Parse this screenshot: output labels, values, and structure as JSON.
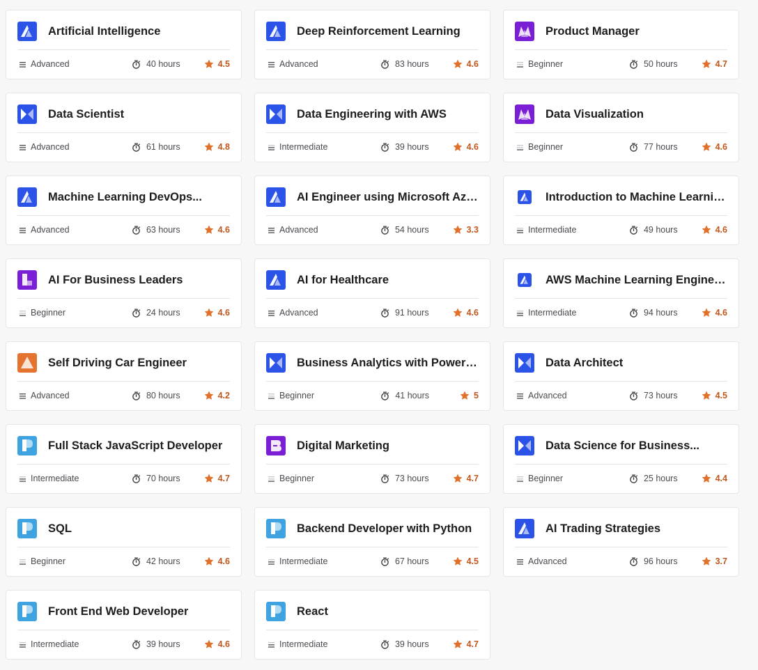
{
  "colors": {
    "blue_logo": "#2b53e8",
    "purple_logo": "#7b1fd6",
    "orange_logo": "#e57330",
    "lightblue_logo": "#3ea3e0",
    "star": "#e0702a",
    "rating_text": "#c0571c"
  },
  "courses": [
    {
      "title": "Artificial Intelligence",
      "level": "Advanced",
      "duration": "40 hours",
      "rating": "4.5",
      "logo": "ai-triangle-logo",
      "logo_color": "#2b53e8"
    },
    {
      "title": "Deep Reinforcement Learning",
      "level": "Advanced",
      "duration": "83 hours",
      "rating": "4.6",
      "logo": "ai-triangle-logo",
      "logo_color": "#2b53e8"
    },
    {
      "title": "Product Manager",
      "level": "Beginner",
      "duration": "50 hours",
      "rating": "4.7",
      "logo": "business-m-logo",
      "logo_color": "#7b1fd6"
    },
    {
      "title": "Data Scientist",
      "level": "Advanced",
      "duration": "61 hours",
      "rating": "4.8",
      "logo": "data-bowtie-logo",
      "logo_color": "#2b53e8"
    },
    {
      "title": "Data Engineering with AWS",
      "level": "Intermediate",
      "duration": "39 hours",
      "rating": "4.6",
      "logo": "data-bowtie-logo",
      "logo_color": "#2b53e8"
    },
    {
      "title": "Data Visualization",
      "level": "Beginner",
      "duration": "77 hours",
      "rating": "4.6",
      "logo": "business-m-logo",
      "logo_color": "#7b1fd6"
    },
    {
      "title": "Machine Learning DevOps...",
      "level": "Advanced",
      "duration": "63 hours",
      "rating": "4.6",
      "logo": "ai-triangle-logo",
      "logo_color": "#2b53e8"
    },
    {
      "title": "AI Engineer using Microsoft Azure",
      "level": "Advanced",
      "duration": "54 hours",
      "rating": "3.3",
      "logo": "ai-triangle-logo",
      "logo_color": "#2b53e8"
    },
    {
      "title": "Introduction to Machine Learning...",
      "level": "Intermediate",
      "duration": "49 hours",
      "rating": "4.6",
      "logo": "ai-triangle-logo",
      "logo_color": "#2b53e8",
      "small_logo": true
    },
    {
      "title": "AI For Business Leaders",
      "level": "Beginner",
      "duration": "24 hours",
      "rating": "4.6",
      "logo": "business-l-logo",
      "logo_color": "#7b1fd6"
    },
    {
      "title": "AI for Healthcare",
      "level": "Advanced",
      "duration": "91 hours",
      "rating": "4.6",
      "logo": "ai-triangle-logo",
      "logo_color": "#2b53e8"
    },
    {
      "title": "AWS Machine Learning Engineer...",
      "level": "Intermediate",
      "duration": "94 hours",
      "rating": "4.6",
      "logo": "ai-triangle-logo",
      "logo_color": "#2b53e8",
      "small_logo": true
    },
    {
      "title": "Self Driving Car Engineer",
      "level": "Advanced",
      "duration": "80 hours",
      "rating": "4.2",
      "logo": "auto-triangle-logo",
      "logo_color": "#e57330"
    },
    {
      "title": "Business Analytics with Power BI",
      "level": "Beginner",
      "duration": "41 hours",
      "rating": "5",
      "logo": "data-bowtie-logo",
      "logo_color": "#2b53e8"
    },
    {
      "title": "Data Architect",
      "level": "Advanced",
      "duration": "73 hours",
      "rating": "4.5",
      "logo": "data-bowtie-logo",
      "logo_color": "#2b53e8"
    },
    {
      "title": "Full Stack JavaScript Developer",
      "level": "Intermediate",
      "duration": "70 hours",
      "rating": "4.7",
      "logo": "programming-p-logo",
      "logo_color": "#3ea3e0"
    },
    {
      "title": "Digital Marketing",
      "level": "Beginner",
      "duration": "73 hours",
      "rating": "4.7",
      "logo": "business-b-logo",
      "logo_color": "#7b1fd6"
    },
    {
      "title": "Data Science for Business...",
      "level": "Beginner",
      "duration": "25 hours",
      "rating": "4.4",
      "logo": "data-bowtie-logo",
      "logo_color": "#2b53e8"
    },
    {
      "title": "SQL",
      "level": "Beginner",
      "duration": "42 hours",
      "rating": "4.6",
      "logo": "programming-p-logo",
      "logo_color": "#3ea3e0"
    },
    {
      "title": "Backend Developer with Python",
      "level": "Intermediate",
      "duration": "67 hours",
      "rating": "4.5",
      "logo": "programming-p-logo",
      "logo_color": "#3ea3e0"
    },
    {
      "title": "AI Trading Strategies",
      "level": "Advanced",
      "duration": "96 hours",
      "rating": "3.7",
      "logo": "ai-triangle-logo",
      "logo_color": "#2b53e8"
    },
    {
      "title": "Front End Web Developer",
      "level": "Intermediate",
      "duration": "39 hours",
      "rating": "4.6",
      "logo": "programming-p-logo",
      "logo_color": "#3ea3e0"
    },
    {
      "title": "React",
      "level": "Intermediate",
      "duration": "39 hours",
      "rating": "4.7",
      "logo": "programming-p-logo",
      "logo_color": "#3ea3e0"
    }
  ]
}
